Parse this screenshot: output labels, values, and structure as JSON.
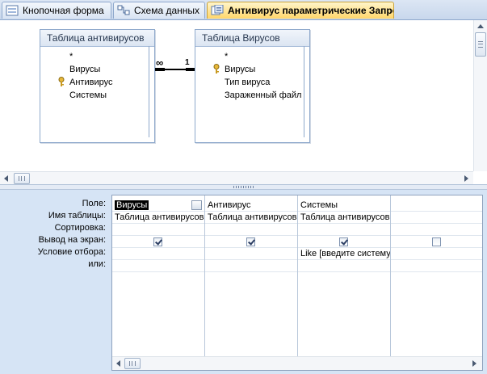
{
  "tabs": [
    {
      "label": "Кнопочная форма",
      "icon": "form-icon",
      "active": false
    },
    {
      "label": "Схема данных",
      "icon": "relationships-icon",
      "active": false
    },
    {
      "label": "Антивирус параметрические Запрос",
      "icon": "query-icon",
      "active": true
    }
  ],
  "relationship_view": {
    "tables": [
      {
        "title": "Таблица антивирусов",
        "fields": [
          {
            "name": "*",
            "key": false
          },
          {
            "name": "Вирусы",
            "key": false
          },
          {
            "name": "Антивирус",
            "key": true
          },
          {
            "name": "Системы",
            "key": false
          }
        ]
      },
      {
        "title": "Таблица Вирусов",
        "fields": [
          {
            "name": "*",
            "key": false
          },
          {
            "name": "Вирусы",
            "key": true
          },
          {
            "name": "Тип вируса",
            "key": false
          },
          {
            "name": "Зараженный файл",
            "key": false
          }
        ]
      }
    ],
    "relationship": {
      "many_symbol": "∞",
      "one_symbol": "1"
    }
  },
  "query_grid": {
    "row_labels": [
      "Поле:",
      "Имя таблицы:",
      "Сортировка:",
      "Вывод на экран:",
      "Условие отбора:",
      "или:"
    ],
    "columns": [
      {
        "field": "Вирусы",
        "table": "Таблица антивирусов",
        "sort": "",
        "show": true,
        "criteria": "",
        "or": "",
        "selected": true
      },
      {
        "field": "Антивирус",
        "table": "Таблица антивирусов",
        "sort": "",
        "show": true,
        "criteria": "",
        "or": ""
      },
      {
        "field": "Системы",
        "table": "Таблица антивирусов",
        "sort": "",
        "show": true,
        "criteria": "Like [введите систему]",
        "or": ""
      },
      {
        "field": "",
        "table": "",
        "sort": "",
        "show": false,
        "criteria": "",
        "or": ""
      }
    ]
  },
  "colors": {
    "accent_tab": "#ffd66b",
    "grid_background": "#d6e4f5",
    "table_border": "#8fa9cc"
  }
}
